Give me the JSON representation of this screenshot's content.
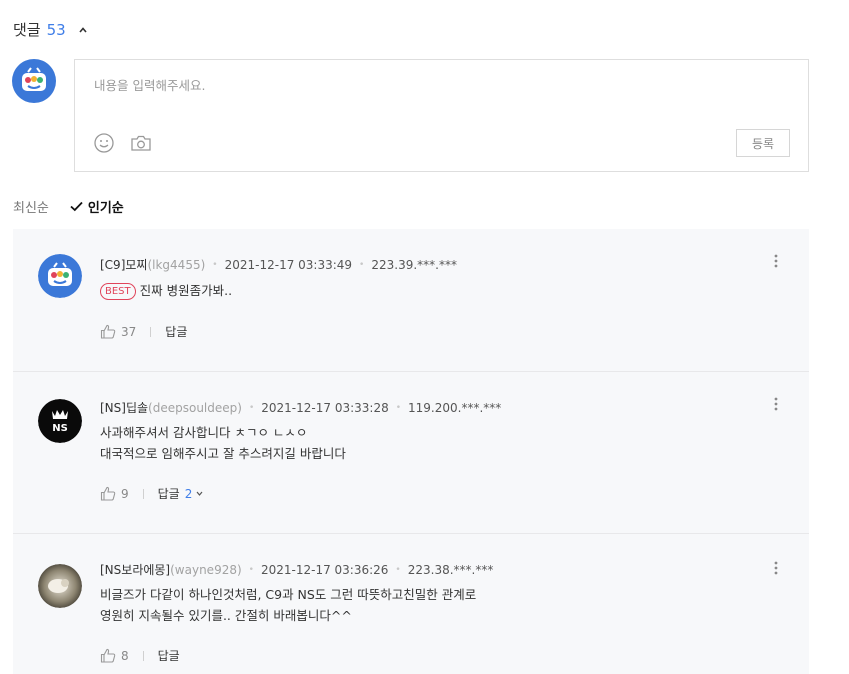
{
  "header": {
    "label": "댓글",
    "count": "53"
  },
  "editor": {
    "placeholder": "내용을 입력해주세요.",
    "submit_label": "등록"
  },
  "sort": {
    "latest": "최신순",
    "popular": "인기순"
  },
  "comments": [
    {
      "nickname": "[C9]모찌",
      "user_id": "(lkg4455)",
      "date": "2021-12-17 03:33:49",
      "ip": "223.39.***.***",
      "best_label": "BEST",
      "lines": [
        "진짜 병원좀가봐.."
      ],
      "likes": "37",
      "reply_label": "답글",
      "reply_count": ""
    },
    {
      "nickname": "[NS]딥솔",
      "user_id": "(deepsouldeep)",
      "date": "2021-12-17 03:33:28",
      "ip": "119.200.***.***",
      "lines": [
        "사과해주셔서 감사합니다 ㅊㄱㅇ ㄴㅅㅇ",
        "대국적으로 임해주시고 잘 추스려지길 바랍니다"
      ],
      "likes": "9",
      "reply_label": "답글",
      "reply_count": "2"
    },
    {
      "nickname": "[NS보라에몽]",
      "user_id": "(wayne928)",
      "date": "2021-12-17 03:36:26",
      "ip": "223.38.***.***",
      "lines": [
        "비글즈가 다같이 하나인것처럼, C9과 NS도 그런 따뜻하고친밀한 관계로",
        "영원히 지속될수 있기를.. 간절히 바래봅니다^^"
      ],
      "likes": "8",
      "reply_label": "답글",
      "reply_count": ""
    }
  ],
  "colors": {
    "accent": "#3f7ee8",
    "best": "#e0445a",
    "list_bg": "#f7f8fa"
  }
}
